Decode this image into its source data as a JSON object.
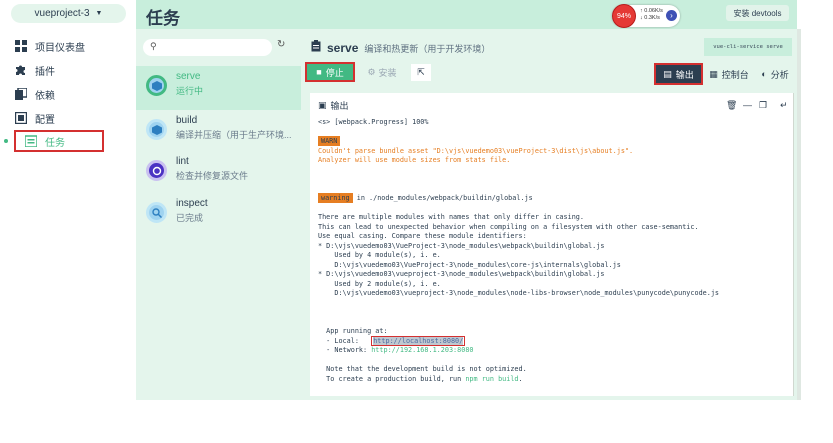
{
  "sidebar": {
    "project": "vueproject-3",
    "items": [
      {
        "label": "项目仪表盘",
        "icon": "dashboard-icon"
      },
      {
        "label": "插件",
        "icon": "puzzle-icon"
      },
      {
        "label": "依赖",
        "icon": "dependencies-icon"
      },
      {
        "label": "配置",
        "icon": "config-icon"
      },
      {
        "label": "任务",
        "icon": "tasks-icon"
      }
    ]
  },
  "header": {
    "title": "任务",
    "speed_percent": "94%",
    "speed_up": "0.06K/s",
    "speed_down": "0.3K/s",
    "devtools": "安装 devtools"
  },
  "tasks": {
    "search_placeholder": "",
    "items": [
      {
        "name": "serve",
        "desc": "运行中"
      },
      {
        "name": "build",
        "desc": "编译并压缩（用于生产环境..."
      },
      {
        "name": "lint",
        "desc": "检查并修复源文件"
      },
      {
        "name": "inspect",
        "desc": "已完成"
      }
    ]
  },
  "main": {
    "task_name": "serve",
    "task_desc": "编译和热更新（用于开发环境）",
    "command": "vue-cli-service serve",
    "stop_label": "停止",
    "install_label": "安装",
    "tabs": {
      "output": "输出",
      "dashboard": "控制台",
      "analyze": "分析"
    },
    "output_title": "输出"
  },
  "log": {
    "l1": "<s> [webpack.Progress] 100%",
    "warn_tag": "WARN",
    "w1": "Couldn't parse bundle asset \"D:\\vjs\\vuedemo03\\vueProject-3\\dist\\js\\about.js\".",
    "w2": "Analyzer will use module sizes from stats file.",
    "warning_tag": "warning",
    "warning_text": " in ./node_modules/webpack/buildin/global.js",
    "m1": "There are multiple modules with names that only differ in casing.",
    "m2": "This can lead to unexpected behavior when compiling on a filesystem with other case-semantic.",
    "m3": "Use equal casing. Compare these module identifiers:",
    "m4": "* D:\\vjs\\vuedemo03\\VueProject-3\\node_modules\\webpack\\buildin\\global.js",
    "m5": "    Used by 4 module(s), i. e.",
    "m6": "    D:\\vjs\\vuedemo03\\VueProject-3\\node_modules\\core-js\\internals\\global.js",
    "m7": "* D:\\vjs\\vuedemo03\\vueproject-3\\node_modules\\webpack\\buildin\\global.js",
    "m8": "    Used by 2 module(s), i. e.",
    "m9": "    D:\\vjs\\vuedemo03\\vueproject-3\\node_modules\\node-libs-browser\\node_modules\\punycode\\punycode.js",
    "a1": "  App running at:",
    "a2": "  - Local:   ",
    "local_url": "http://localhost:8080/",
    "a3": "  - Network: ",
    "network_url": "http://192.168.1.203:8080",
    "n1": "  Note that the development build is not optimized.",
    "n2a": "  To create a production build, run ",
    "n2b": "npm run build",
    "n2c": "."
  },
  "colors": {
    "accent": "#42b983",
    "highlight": "#d43030",
    "dark": "#2c3e50",
    "panel": "#e4f5ec"
  }
}
